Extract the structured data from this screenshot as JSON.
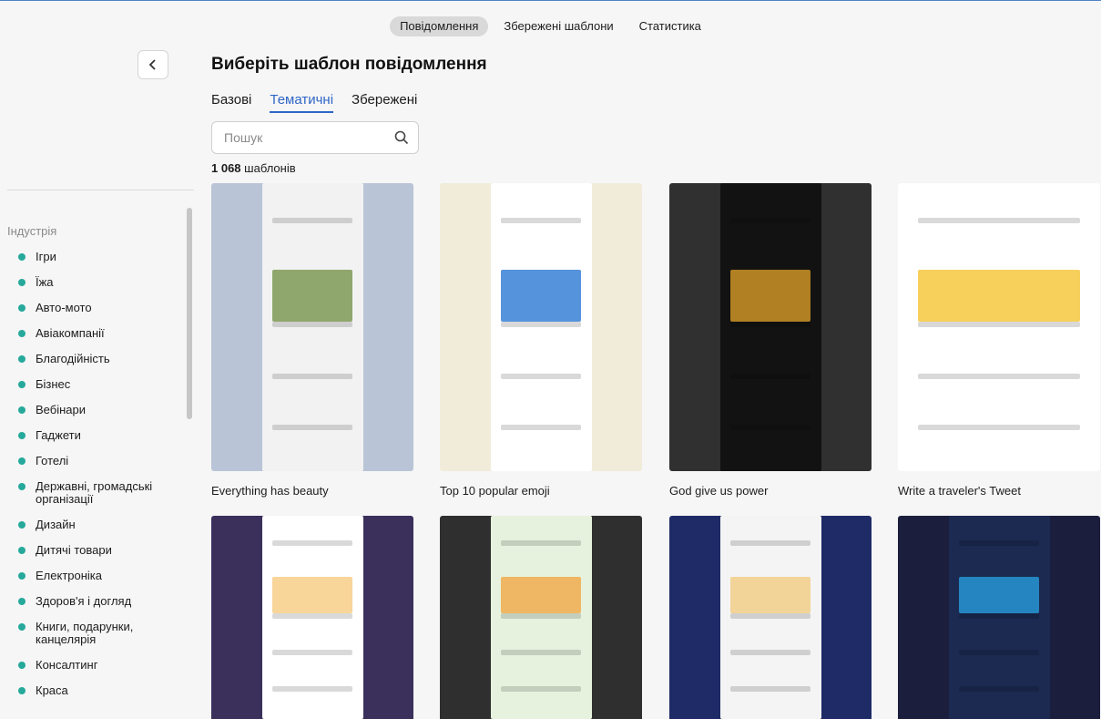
{
  "top_nav": {
    "tabs": [
      "Повідомлення",
      "Збережені шаблони",
      "Статистика"
    ],
    "active_index": 0
  },
  "header": {
    "title": "Виберіть шаблон повідомлення"
  },
  "sub_tabs": {
    "items": [
      "Базові",
      "Тематичні",
      "Збережені"
    ],
    "active_index": 1
  },
  "search": {
    "placeholder": "Пошук",
    "value": ""
  },
  "count": {
    "number": "1 068",
    "label": "шаблонів"
  },
  "sidebar": {
    "heading": "Індустрія",
    "items": [
      "Ігри",
      "Їжа",
      "Авто-мото",
      "Авіакомпанії",
      "Благодійність",
      "Бізнес",
      "Вебінари",
      "Гаджети",
      "Готелі",
      "Державні, громадські організації",
      "Дизайн",
      "Дитячі товари",
      "Електроніка",
      "Здоров'я і догляд",
      "Книги, подарунки, канцелярія",
      "Консалтинг",
      "Краса"
    ]
  },
  "templates": [
    {
      "name": "Everything has beauty",
      "bg": "#b9c4d6",
      "mock": "#f2f2f2",
      "accent": "#6d8d3f"
    },
    {
      "name": "Top 10 popular emoji",
      "bg": "#f1ecd9",
      "mock": "#ffffff",
      "accent": "#1e6fd1"
    },
    {
      "name": "God give us power",
      "bg": "#303030",
      "mock": "#121212",
      "accent": "#e5a628"
    },
    {
      "name": "Write a traveler's Tweet",
      "bg": "#f3f0e2",
      "mock": "#ffffff",
      "accent": "#f4c025"
    },
    {
      "name": "",
      "bg": "#3b2f5c",
      "mock": "#ffffff",
      "accent": "#f5c777"
    },
    {
      "name": "",
      "bg": "#2f2f2f",
      "mock": "#e6f2dd",
      "accent": "#f2a33a"
    },
    {
      "name": "",
      "bg": "#1e2b66",
      "mock": "#f4f4f4",
      "accent": "#f1c879"
    },
    {
      "name": "",
      "bg": "#1b1f3d",
      "mock": "#1c2a52",
      "accent": "#27a4e5"
    }
  ]
}
